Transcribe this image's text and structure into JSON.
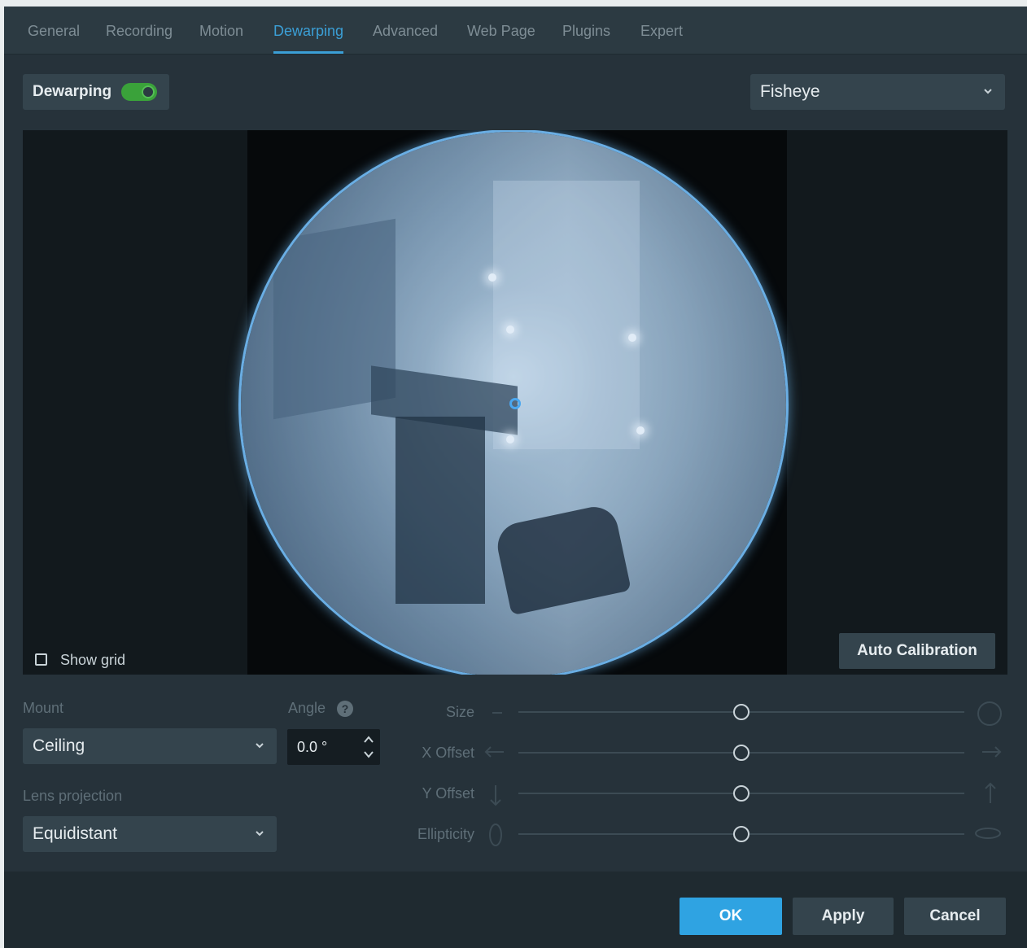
{
  "tabs": [
    {
      "label": "General"
    },
    {
      "label": "Recording"
    },
    {
      "label": "Motion"
    },
    {
      "label": "Dewarping"
    },
    {
      "label": "Advanced"
    },
    {
      "label": "Web Page"
    },
    {
      "label": "Plugins"
    },
    {
      "label": "Expert"
    }
  ],
  "active_tab": "Dewarping",
  "dewarping": {
    "label": "Dewarping",
    "enabled": true
  },
  "lens_type_select": {
    "value": "Fisheye"
  },
  "preview": {
    "show_grid_label": "Show grid",
    "show_grid_checked": false,
    "auto_calibration_label": "Auto Calibration"
  },
  "mount": {
    "label": "Mount",
    "value": "Ceiling"
  },
  "angle": {
    "label": "Angle",
    "value": "0.0 °"
  },
  "lens_projection": {
    "label": "Lens projection",
    "value": "Equidistant"
  },
  "sliders": [
    {
      "label": "Size",
      "position": 0.5
    },
    {
      "label": "X Offset",
      "position": 0.5
    },
    {
      "label": "Y Offset",
      "position": 0.5
    },
    {
      "label": "Ellipticity",
      "position": 0.5
    }
  ],
  "footer": {
    "ok_label": "OK",
    "apply_label": "Apply",
    "cancel_label": "Cancel"
  },
  "colors": {
    "accent": "#2fa3e2",
    "toggle_on": "#3aa23a",
    "background": "#26323a"
  }
}
